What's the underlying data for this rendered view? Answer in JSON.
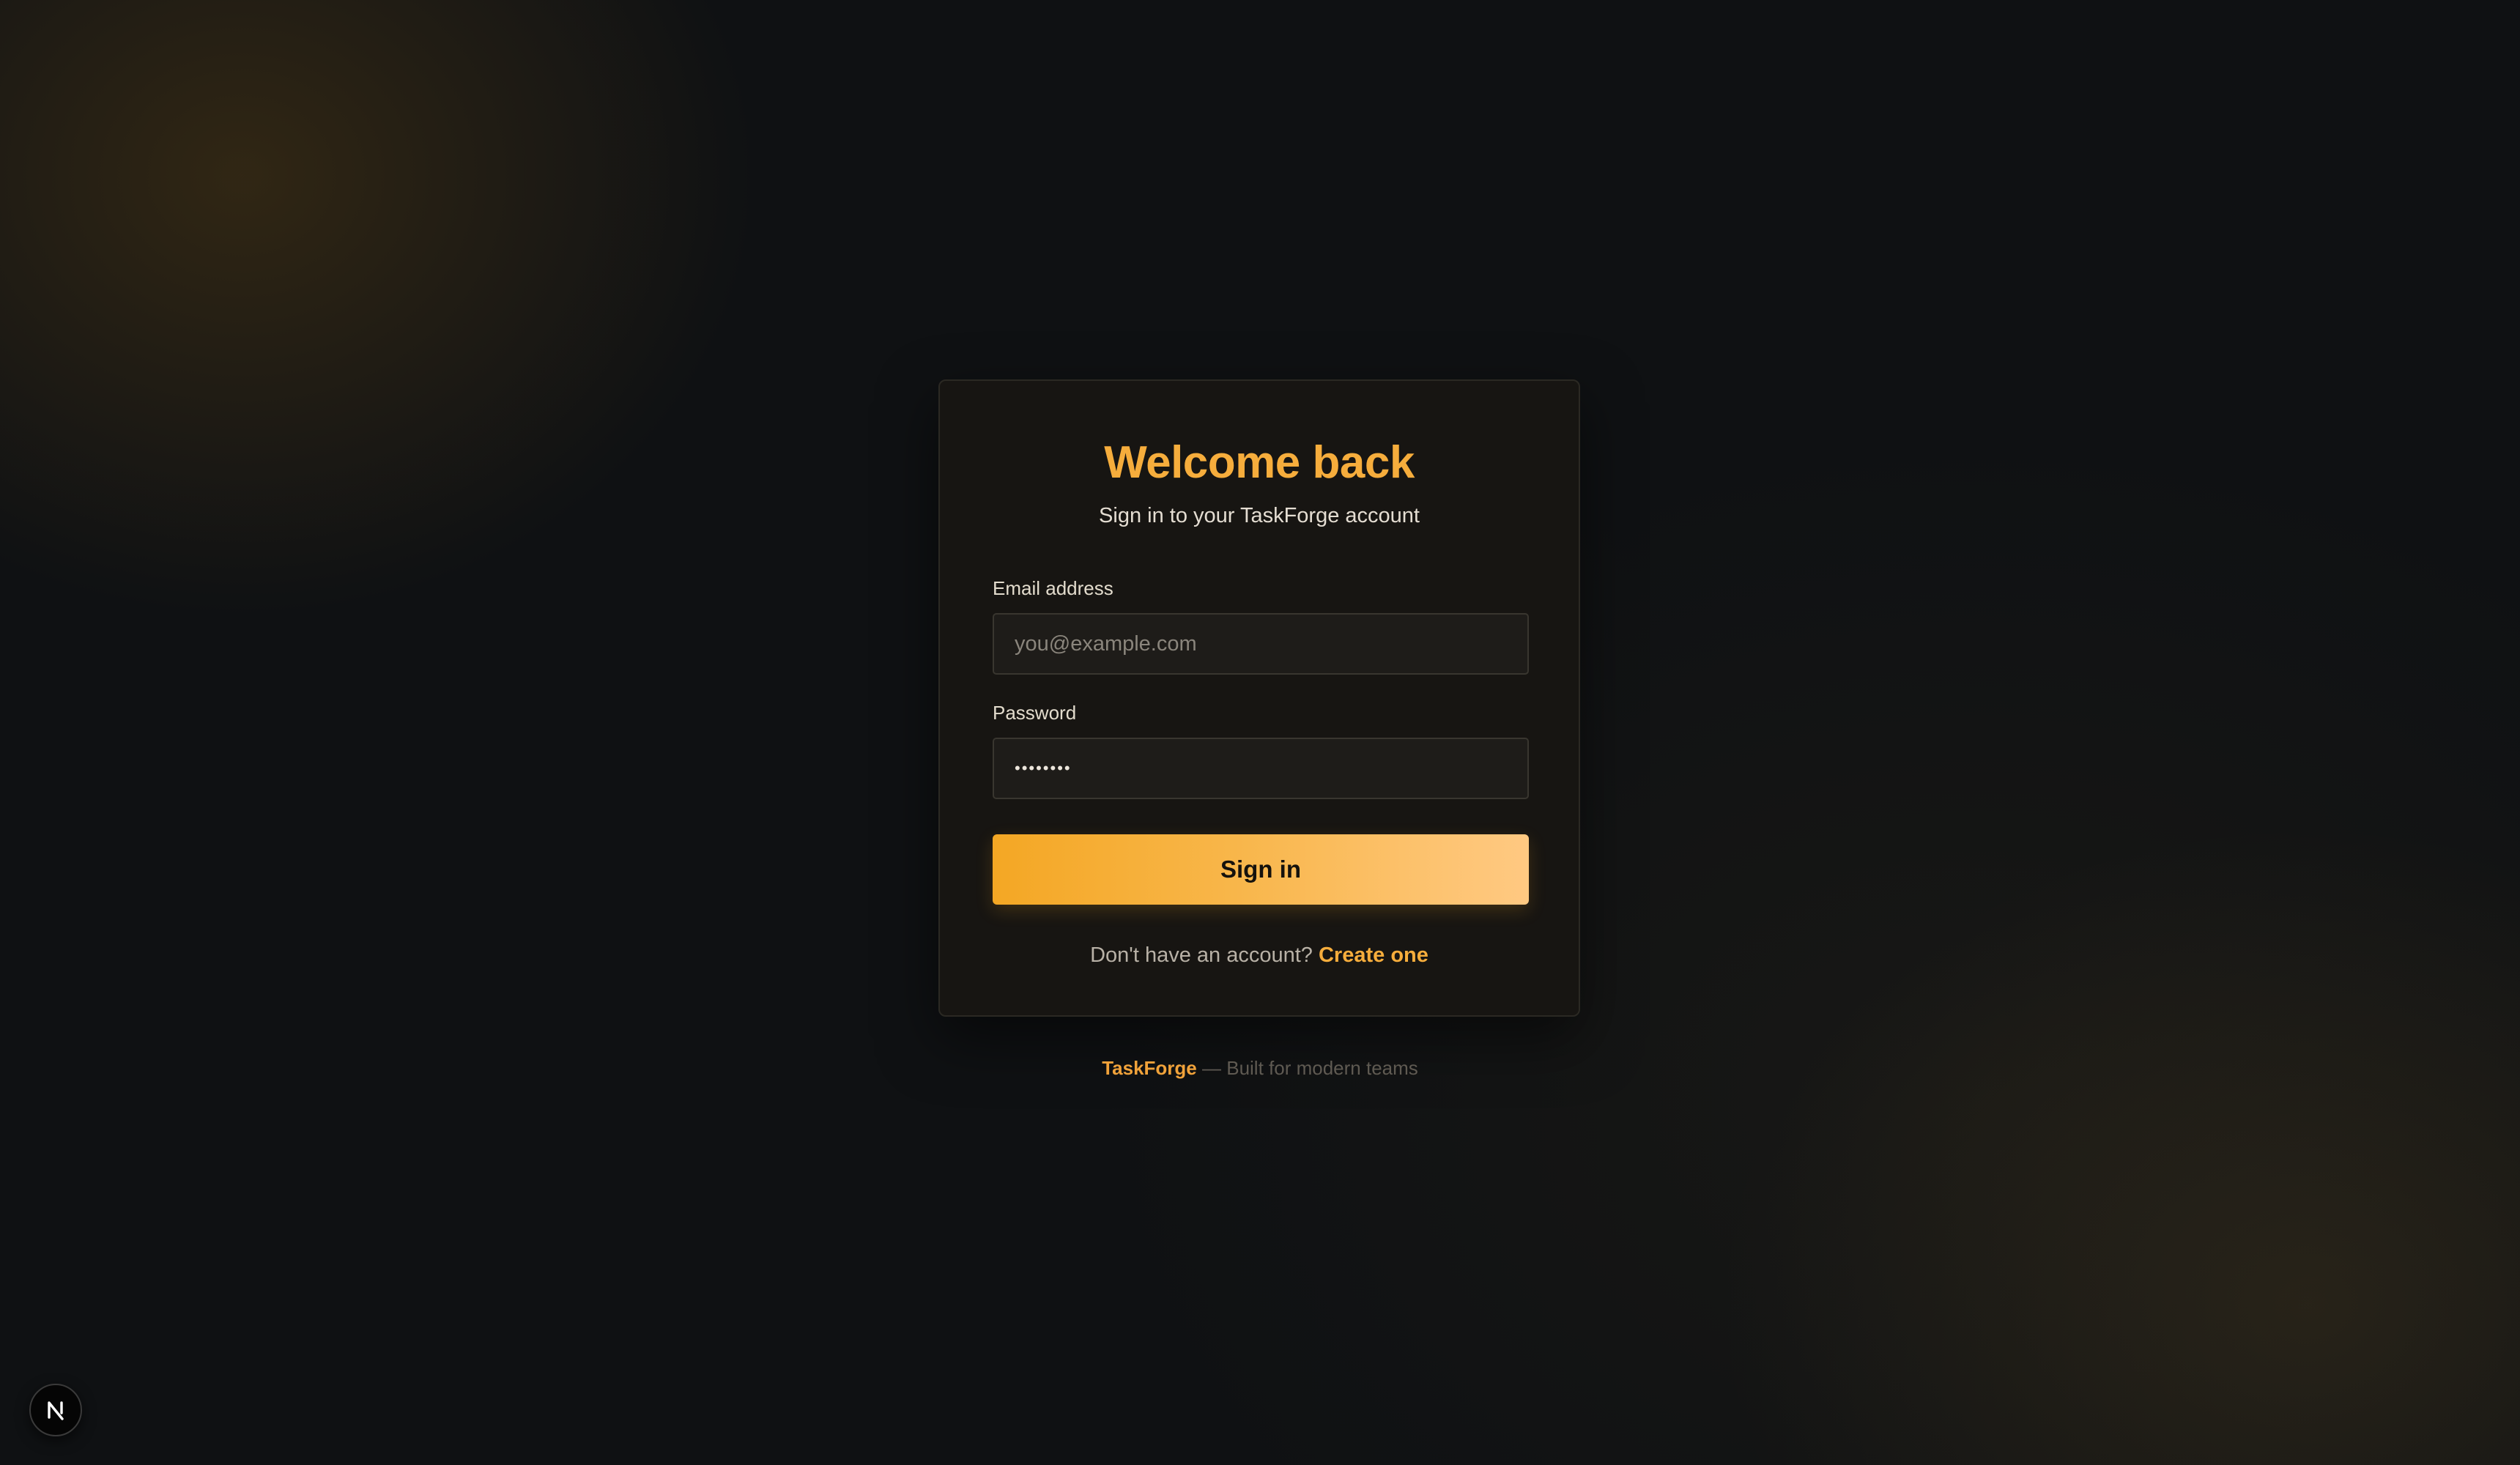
{
  "login": {
    "title": "Welcome back",
    "subtitle": "Sign in to your TaskForge account",
    "email": {
      "label": "Email address",
      "placeholder": "you@example.com",
      "value": ""
    },
    "password": {
      "label": "Password",
      "value": "••••••••"
    },
    "submit_label": "Sign in",
    "signup_prompt": "Don't have an account?",
    "signup_link": "Create one"
  },
  "footer": {
    "brand": "TaskForge",
    "tagline": "— Built for modern teams"
  },
  "dev_badge": {
    "icon": "nextjs-n-icon"
  },
  "colors": {
    "accent": "#f6ad3c",
    "button_gradient_start": "#f4a724",
    "button_gradient_end": "#ffc982",
    "background": "#0f1113",
    "card": "#171512"
  }
}
